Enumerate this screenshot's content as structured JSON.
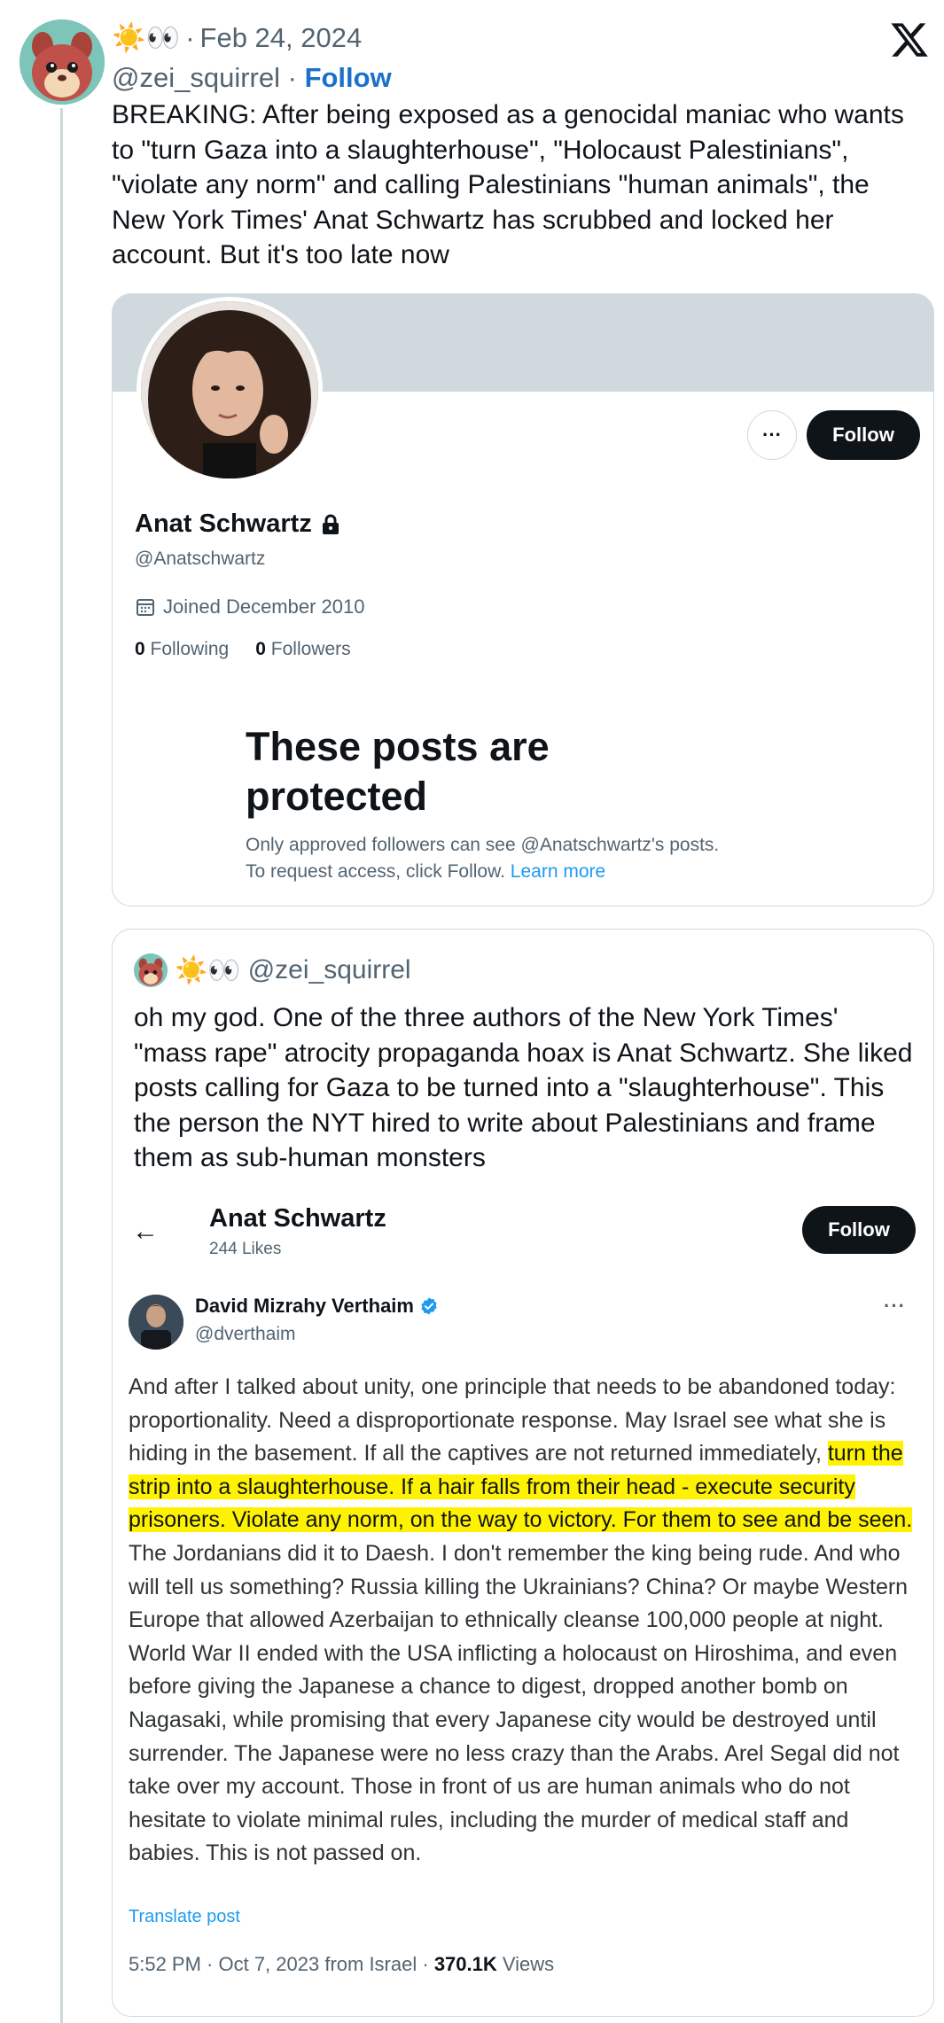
{
  "tweet": {
    "emoji": "☀️👀",
    "date": "Feb 24, 2024",
    "handle": "@zei_squirrel",
    "separator": "·",
    "follow_label": "Follow",
    "text": "BREAKING: After being exposed as a genocidal maniac who wants to \"turn Gaza into a slaughterhouse\", \"Holocaust Palestinians\", \"violate any norm\" and calling Palestinians \"human animals\", the New York Times' Anat Schwartz has scrubbed and locked her account. But it's too late now"
  },
  "profile_card": {
    "more_label": "···",
    "follow_label": "Follow",
    "name": "Anat Schwartz",
    "handle": "@Anatschwartz",
    "joined": "Joined December 2010",
    "following_count": "0",
    "following_label": "Following",
    "followers_count": "0",
    "followers_label": "Followers",
    "protected_title": "These posts are protected",
    "protected_sub": "Only approved followers can see @Anatschwartz's posts. To request access, click Follow.",
    "learn_more": "Learn more"
  },
  "quote": {
    "emoji": "☀️👀",
    "handle": "@zei_squirrel",
    "text": "oh my god. One of the three authors of the New York Times' \"mass rape\" atrocity propaganda hoax is Anat Schwartz. She liked posts calling for Gaza to be turned into a \"slaughterhouse\". This the person the NYT hired to write about Palestinians and frame them as sub-human monsters"
  },
  "inner": {
    "back_arrow": "←",
    "name": "Anat Schwartz",
    "likes": "244 Likes",
    "follow_label": "Follow",
    "author_name": "David Mizrahy Verthaim",
    "author_handle": "@dverthaim",
    "more_label": "···",
    "text_before": "And after I talked about unity, one principle that needs to be abandoned today: proportionality. Need a disproportionate response. May Israel see what she is hiding in the basement. If all the captives are not returned immediately, ",
    "text_highlight": "turn the strip into a slaughterhouse. If a hair falls from their head - execute security prisoners. Violate any norm, on the way to victory. For them to see and be seen.",
    "text_after": " The Jordanians did it to Daesh. I don't remember the king being rude. And who will tell us something? Russia killing the Ukrainians? China? Or maybe Western Europe that allowed Azerbaijan to ethnically cleanse 100,000 people at night. World War II ended with the USA inflicting a holocaust on Hiroshima, and even before giving the Japanese a chance to digest, dropped another bomb on Nagasaki, while promising that every Japanese city would be destroyed until surrender. The Japanese were no less crazy than the Arabs. Arel Segal did not take over my account. Those in front of us are human animals who do not hesitate to violate minimal rules, including the murder of medical staff and babies. This is not passed on.",
    "translate": "Translate post",
    "timestamp": "5:52 PM · Oct 7, 2023 from Israel ·",
    "views_count": "370.1K",
    "views_label": "Views"
  },
  "colors": {
    "link": "#1d70c8",
    "highlight": "#fff200",
    "verified": "#1d9bf0"
  }
}
